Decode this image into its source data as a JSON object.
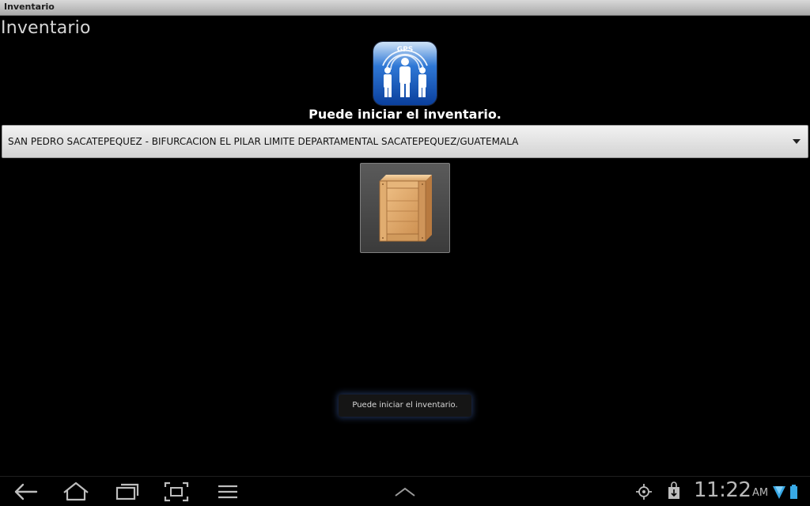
{
  "window": {
    "title": "Inventario"
  },
  "app": {
    "title": "Inventario"
  },
  "logo": {
    "label": "GPS"
  },
  "status": {
    "message": "Puede iniciar el inventario."
  },
  "location_select": {
    "selected": "SAN PEDRO SACATEPEQUEZ - BIFURCACION EL PILAR LIMITE DEPARTAMENTAL SACATEPEQUEZ/GUATEMALA"
  },
  "toast": {
    "message": "Puede iniciar el inventario."
  },
  "system_bar": {
    "time": "11:22",
    "ampm": "AM"
  },
  "colors": {
    "background": "#000000",
    "logo_blue": "#0a3f9c",
    "toast_glow": "#385696"
  }
}
